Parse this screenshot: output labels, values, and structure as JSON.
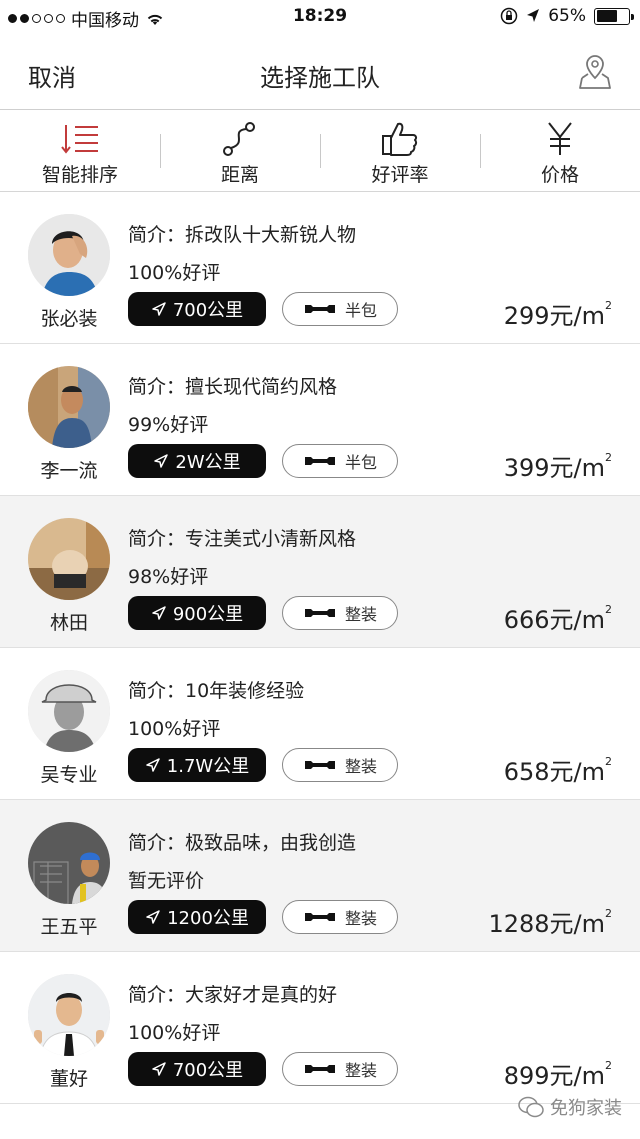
{
  "status_bar": {
    "carrier": "中国移动",
    "time": "18:29",
    "battery_text": "65%",
    "battery_level": 0.65,
    "signal_bars": 2
  },
  "nav": {
    "cancel_label": "取消",
    "title": "选择施工队",
    "map_icon": "map-pin-icon"
  },
  "sort": {
    "items": [
      {
        "label": "智能排序",
        "icon": "sort-lines-icon",
        "active": true
      },
      {
        "label": "距离",
        "icon": "route-icon",
        "active": false
      },
      {
        "label": "好评率",
        "icon": "thumbs-up-icon",
        "active": false
      },
      {
        "label": "价格",
        "icon": "yen-icon",
        "active": false
      }
    ]
  },
  "teams": [
    {
      "name": "张必装",
      "intro": "简介：拆改队十大新锐人物",
      "rating": "100%好评",
      "distance": "700公里",
      "package": "半包",
      "price": "299元/m",
      "price_sup": "2"
    },
    {
      "name": "李一流",
      "intro": "简介：擅长现代简约风格",
      "rating": "99%好评",
      "distance": "2W公里",
      "package": "半包",
      "price": "399元/m",
      "price_sup": "2"
    },
    {
      "name": "林田",
      "intro": "简介：专注美式小清新风格",
      "rating": "98%好评",
      "distance": "900公里",
      "package": "整装",
      "price": "666元/m",
      "price_sup": "2"
    },
    {
      "name": "吴专业",
      "intro": "简介：10年装修经验",
      "rating": "100%好评",
      "distance": "1.7W公里",
      "package": "整装",
      "price": "658元/m",
      "price_sup": "2"
    },
    {
      "name": "王五平",
      "intro": "简介：极致品味，由我创造",
      "rating": "暂无评价",
      "distance": "1200公里",
      "package": "整装",
      "price": "1288元/m",
      "price_sup": "2"
    },
    {
      "name": "董好",
      "intro": "简介：大家好才是真的好",
      "rating": "100%好评",
      "distance": "700公里",
      "package": "整装",
      "price": "899元/m",
      "price_sup": "2"
    }
  ],
  "watermark": "免狗家装",
  "colors": {
    "accent_red": "#c23b3b",
    "pill_dark": "#0d0d0d",
    "shade": "#f3f3f3"
  }
}
